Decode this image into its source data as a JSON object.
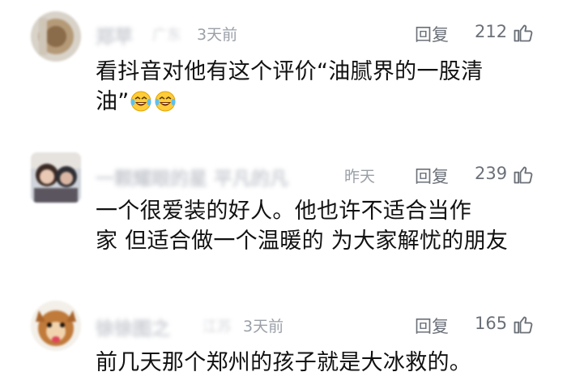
{
  "comments": [
    {
      "username": "郑苹",
      "location": "广东",
      "time": "3天前",
      "reply_label": "回复",
      "likes": "212",
      "text": "看抖音对他有这个评价“油腻界的一股清\n油”",
      "emoji": [
        "laughing-tears",
        "laughing-tears"
      ]
    },
    {
      "username": "一颗耀眼的星 平凡的凡",
      "location": "",
      "time": "昨天",
      "reply_label": "回复",
      "likes": "239",
      "text": "一个很爱装的好人。他也许不适合当作\n家 但适合做一个温暖的 为大家解忧的朋友"
    },
    {
      "username": "徐徐图之",
      "location": "江苏",
      "time": "3天前",
      "reply_label": "回复",
      "likes": "165",
      "text": "前几天那个郑州的孩子就是大冰救的。"
    }
  ]
}
